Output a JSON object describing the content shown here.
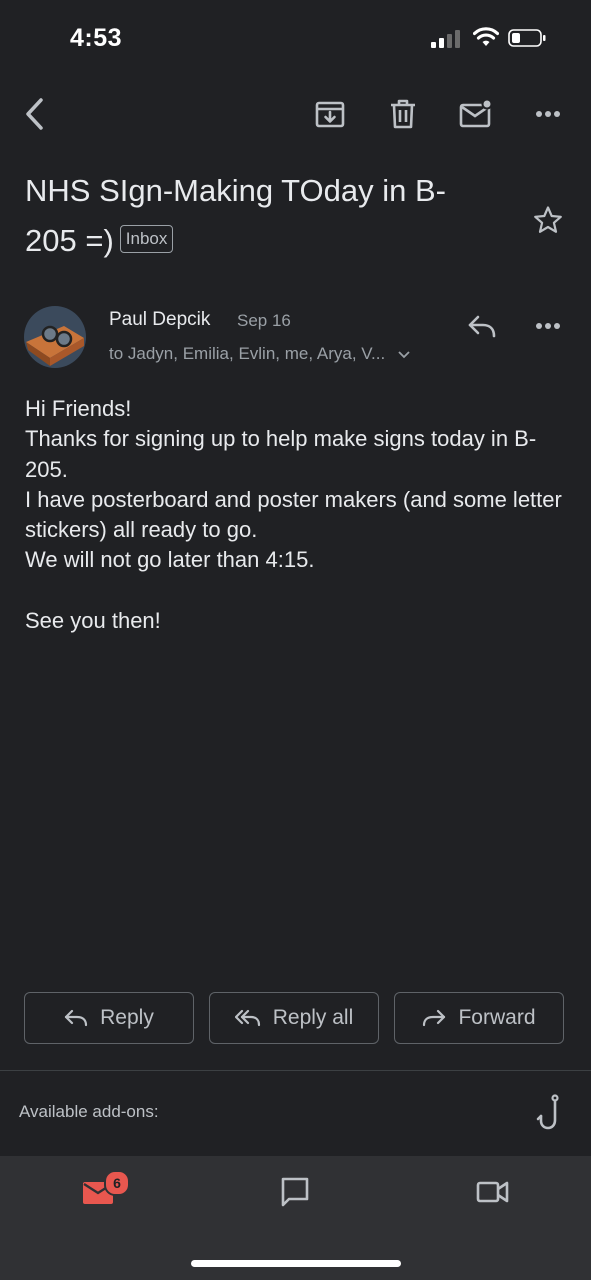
{
  "status_bar": {
    "time": "4:53"
  },
  "email": {
    "subject": "NHS SIgn-Making TOday in B-205 =)",
    "label": "Inbox",
    "sender": {
      "name": "Paul Depcik",
      "date": "Sep 16"
    },
    "recipients": "to Jadyn, Emilia, Evlin, me, Arya, V...",
    "body": [
      "Hi Friends!",
      "Thanks for signing up to help make signs today in B-205.",
      "I have posterboard and poster makers (and some letter stickers) all ready to go.",
      "We will not go later than 4:15.",
      "",
      "See you then!"
    ]
  },
  "actions": {
    "reply": "Reply",
    "reply_all": "Reply all",
    "forward": "Forward"
  },
  "addons": {
    "label": "Available add-ons:"
  },
  "bottom_nav": {
    "mail_badge": "6",
    "accent": "#e8574f"
  },
  "icons": [
    "back-icon",
    "archive-icon",
    "delete-icon",
    "mark-unread-icon",
    "more-icon",
    "star-icon",
    "reply-icon",
    "more-vert-icon",
    "chevron-down-icon",
    "hook-icon",
    "mail-icon",
    "chat-icon",
    "video-icon"
  ]
}
